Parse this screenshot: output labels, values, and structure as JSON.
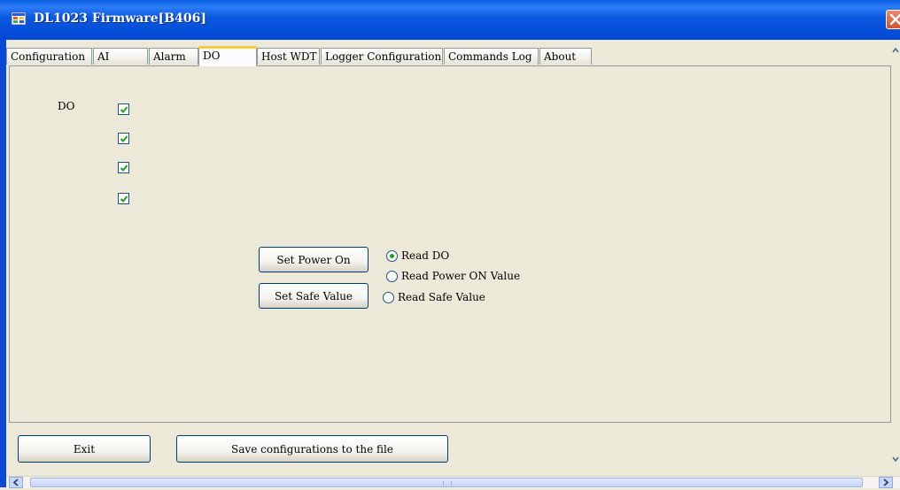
{
  "window": {
    "title": "DL1023 Firmware[B406]",
    "icon": "app-window-icon"
  },
  "tabs": [
    {
      "label": "Configuration",
      "active": false
    },
    {
      "label": "AI",
      "active": false
    },
    {
      "label": "Alarm",
      "active": false
    },
    {
      "label": "DO",
      "active": true
    },
    {
      "label": "Host WDT",
      "active": false
    },
    {
      "label": "Logger Configuration",
      "active": false
    },
    {
      "label": "Commands Log",
      "active": false
    },
    {
      "label": "About",
      "active": false
    }
  ],
  "do_panel": {
    "label": "DO",
    "checkboxes": [
      {
        "checked": true
      },
      {
        "checked": true
      },
      {
        "checked": true
      },
      {
        "checked": true
      }
    ],
    "set_power_on_label": "Set Power On",
    "set_safe_value_label": "Set Safe Value",
    "read_options": [
      {
        "label": "Read DO",
        "selected": true
      },
      {
        "label": "Read Power ON Value",
        "selected": false
      },
      {
        "label": "Read Safe Value",
        "selected": false
      }
    ]
  },
  "footer": {
    "exit_label": "Exit",
    "save_label": "Save configurations to the file"
  },
  "colors": {
    "titlebar": "#0a58e0",
    "window_bg": "#ece9d8",
    "active_tab_accent": "#ffc83c",
    "check_mark": "#21a121",
    "close_button": "#d2542d"
  }
}
